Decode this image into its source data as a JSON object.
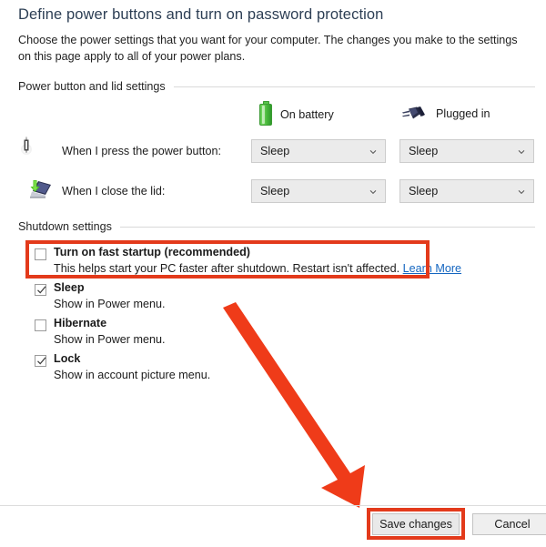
{
  "header": {
    "title": "Define power buttons and turn on password protection",
    "description": "Choose the power settings that you want for your computer. The changes you make to the settings on this page apply to all of your power plans."
  },
  "sections": {
    "power_lid": {
      "label": "Power button and lid settings",
      "columns": [
        {
          "label": "On battery",
          "icon": "battery-icon"
        },
        {
          "label": "Plugged in",
          "icon": "plug-icon"
        }
      ],
      "rows": [
        {
          "label": "When I press the power button:",
          "icon": "power-button-icon",
          "on_battery": "Sleep",
          "plugged_in": "Sleep"
        },
        {
          "label": "When I close the lid:",
          "icon": "laptop-lid-icon",
          "on_battery": "Sleep",
          "plugged_in": "Sleep"
        }
      ]
    },
    "shutdown": {
      "label": "Shutdown settings",
      "options": [
        {
          "title": "Turn on fast startup (recommended)",
          "description": "This helps start your PC faster after shutdown. Restart isn't affected.",
          "link": "Learn More",
          "checked": false,
          "highlighted": true
        },
        {
          "title": "Sleep",
          "description": "Show in Power menu.",
          "link": "",
          "checked": true,
          "highlighted": false
        },
        {
          "title": "Hibernate",
          "description": "Show in Power menu.",
          "link": "",
          "checked": false,
          "highlighted": false
        },
        {
          "title": "Lock",
          "description": "Show in account picture menu.",
          "link": "",
          "checked": true,
          "highlighted": false
        }
      ]
    }
  },
  "footer": {
    "save_label": "Save changes",
    "cancel_label": "Cancel"
  },
  "annotations": {
    "highlight_color": "#e33a1b",
    "arrow_color": "#ef3b19",
    "arrow_target": "Save changes",
    "highlight_targets": [
      "Turn on fast startup (recommended)",
      "Save changes"
    ]
  },
  "colors": {
    "title": "#2c3e54",
    "link": "#1566c0",
    "combo_fill": "#ebebeb",
    "battery": "#4fbd41",
    "plug": "#2b2f4a"
  }
}
